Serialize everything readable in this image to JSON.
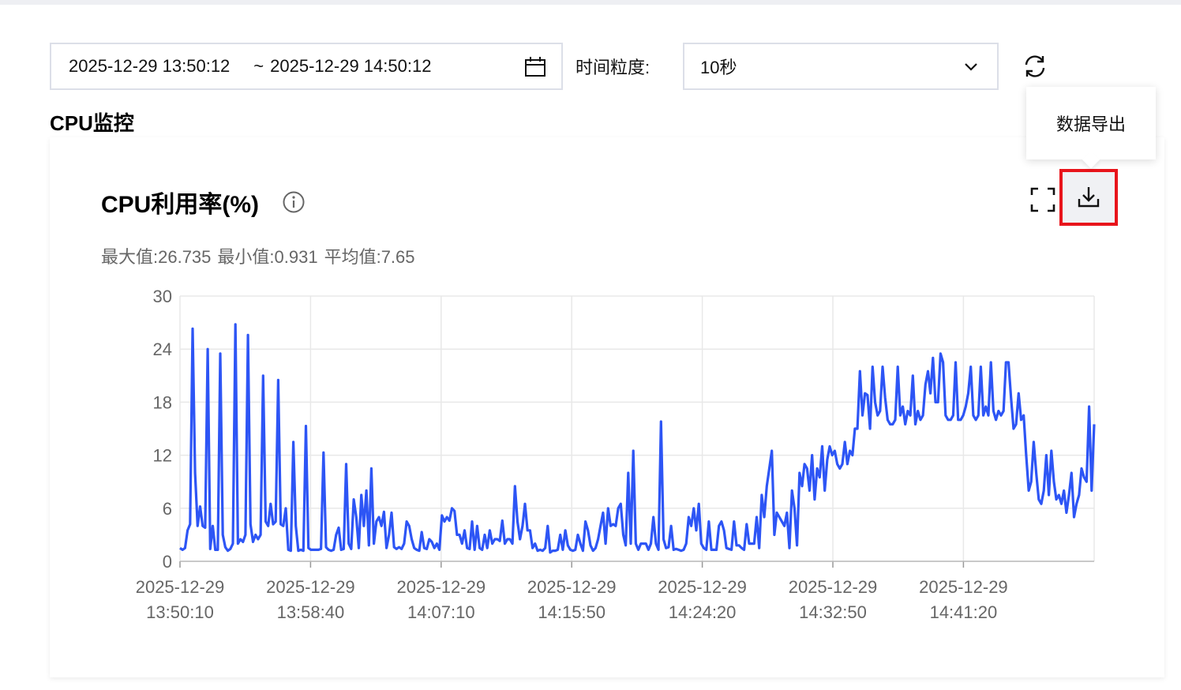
{
  "toolbar": {
    "date_start": "2025-12-29 13:50:12",
    "date_sep": "~",
    "date_end": "2025-12-29 14:50:12",
    "granularity_label": "时间粒度:",
    "granularity_value": "10秒"
  },
  "section_title": "CPU监控",
  "card": {
    "chart_title": "CPU利用率(%)",
    "stats": {
      "max": "最大值:26.735",
      "min": "最小值:0.931",
      "avg": "平均值:7.65"
    },
    "tooltip": "数据导出"
  },
  "icons": {
    "calendar": "calendar-icon",
    "chevron": "chevron-down-icon",
    "refresh": "refresh-icon",
    "info": "info-icon",
    "fullscreen": "fullscreen-icon",
    "download": "download-icon"
  },
  "colors": {
    "line": "#2d55f5",
    "highlight": "#e8141b",
    "grid": "#e8e8e8",
    "axis_text": "#666666"
  },
  "chart_data": {
    "type": "line",
    "yticks": [
      0,
      6,
      12,
      18,
      24,
      30
    ],
    "ylim": [
      0,
      30
    ],
    "xticks": [
      {
        "date": "2025-12-29",
        "time": "13:50:10"
      },
      {
        "date": "2025-12-29",
        "time": "13:58:40"
      },
      {
        "date": "2025-12-29",
        "time": "14:07:10"
      },
      {
        "date": "2025-12-29",
        "time": "14:15:50"
      },
      {
        "date": "2025-12-29",
        "time": "14:24:20"
      },
      {
        "date": "2025-12-29",
        "time": "14:32:50"
      },
      {
        "date": "2025-12-29",
        "time": "14:41:20"
      }
    ],
    "series": [
      {
        "values": [
          1.5,
          1.3,
          1.5,
          3.5,
          4.2,
          26.3,
          10.0,
          4.0,
          6.2,
          4.0,
          3.8,
          24.0,
          1.4,
          4.0,
          1.3,
          1.3,
          23.5,
          3.0,
          1.6,
          1.2,
          1.4,
          2.0,
          26.8,
          2.0,
          2.5,
          2.2,
          3.0,
          25.6,
          4.2,
          2.2,
          3.0,
          2.5,
          3.0,
          21.0,
          4.5,
          4.0,
          6.5,
          4.2,
          4.5,
          20.5,
          4.2,
          4.0,
          6.0,
          1.3,
          1.2,
          13.5,
          4.0,
          1.2,
          1.3,
          1.2,
          15.3,
          1.5,
          1.3,
          1.3,
          1.3,
          1.3,
          1.4,
          12.3,
          1.6,
          1.3,
          1.2,
          1.3,
          3.0,
          3.8,
          1.3,
          1.4,
          11.0,
          2.0,
          1.4,
          7.0,
          5.0,
          1.5,
          7.5,
          4.0,
          8.0,
          1.8,
          10.5,
          2.0,
          4.5,
          5.0,
          4.0,
          5.6,
          1.5,
          3.0,
          5.5,
          1.6,
          1.4,
          1.6,
          1.4,
          2.0,
          4.5,
          4.0,
          2.5,
          1.5,
          1.3,
          1.2,
          3.3,
          1.5,
          1.4,
          2.5,
          2.2,
          1.5,
          2.0,
          1.3,
          5.2,
          4.5,
          5.0,
          4.6,
          6.0,
          5.7,
          3.0,
          3.0,
          2.0,
          3.5,
          1.5,
          1.4,
          4.5,
          1.3,
          4.0,
          1.5,
          1.3,
          3.0,
          1.5,
          3.5,
          2.0,
          2.5,
          2.5,
          2.3,
          4.6,
          2.0,
          2.5,
          2.5,
          2.0,
          8.5,
          4.5,
          2.5,
          4.0,
          6.5,
          3.5,
          3.5,
          1.5,
          2.0,
          1.2,
          1.3,
          1.2,
          1.5,
          4.0,
          1.0,
          1.2,
          1.2,
          1.3,
          3.0,
          1.3,
          3.5,
          1.8,
          1.3,
          1.2,
          1.3,
          3.0,
          2.0,
          1.2,
          4.5,
          3.5,
          1.8,
          1.2,
          1.5,
          2.5,
          4.0,
          5.5,
          2.0,
          6.0,
          4.0,
          4.2,
          4.0,
          6.0,
          6.5,
          3.0,
          1.8,
          10.0,
          2.0,
          12.5,
          2.0,
          1.3,
          2.0,
          2.0,
          2.0,
          1.3,
          2.0,
          5.0,
          2.0,
          1.3,
          15.8,
          2.5,
          1.5,
          1.6,
          4.0,
          1.3,
          1.4,
          1.3,
          1.2,
          1.3,
          2.0,
          5.0,
          4.0,
          6.0,
          3.5,
          6.5,
          2.0,
          1.5,
          1.3,
          4.5,
          1.3,
          1.3,
          1.3,
          4.0,
          4.5,
          3.5,
          1.5,
          1.4,
          1.3,
          4.5,
          1.8,
          1.8,
          1.5,
          1.3,
          4.2,
          2.0,
          2.0,
          2.0,
          5.0,
          1.5,
          7.5,
          5.0,
          8.5,
          10.5,
          12.5,
          3.0,
          5.5,
          5.0,
          4.5,
          4.0,
          5.5,
          1.5,
          8.0,
          6.0,
          1.8,
          10.0,
          8.5,
          11.0,
          10.5,
          8.0,
          12.0,
          7.0,
          10.5,
          9.5,
          13.0,
          8.0,
          11.5,
          13.0,
          12.0,
          12.5,
          11.0,
          10.5,
          11.0,
          13.5,
          11.0,
          12.5,
          12.0,
          15.0,
          15.0,
          21.5,
          16.5,
          19.0,
          18.8,
          15.0,
          22.0,
          18.0,
          16.5,
          17.0,
          22.0,
          18.5,
          16.0,
          15.5,
          15.5,
          16.0,
          22.0,
          16.5,
          17.5,
          15.5,
          17.0,
          16.5,
          21.0,
          15.5,
          17.0,
          16.0,
          16.5,
          20.0,
          21.5,
          19.0,
          23.0,
          18.0,
          18.0,
          23.5,
          22.5,
          16.5,
          16.0,
          16.0,
          16.5,
          22.5,
          16.0,
          16.0,
          16.5,
          17.5,
          19.0,
          22.0,
          16.5,
          16.0,
          16.5,
          22.0,
          16.5,
          17.5,
          16.5,
          22.5,
          17.0,
          16.0,
          17.0,
          16.5,
          17.0,
          22.5,
          22.5,
          18.5,
          15.0,
          15.5,
          19.0,
          16.0,
          16.5,
          12.0,
          8.0,
          9.0,
          13.5,
          10.0,
          7.0,
          6.5,
          8.0,
          12.0,
          7.5,
          12.5,
          9.0,
          7.0,
          7.5,
          6.5,
          8.0,
          5.5,
          7.5,
          10.0,
          5.0,
          6.5,
          7.5,
          10.5,
          9.5,
          9.0,
          17.5,
          8.0,
          15.5
        ]
      }
    ]
  }
}
